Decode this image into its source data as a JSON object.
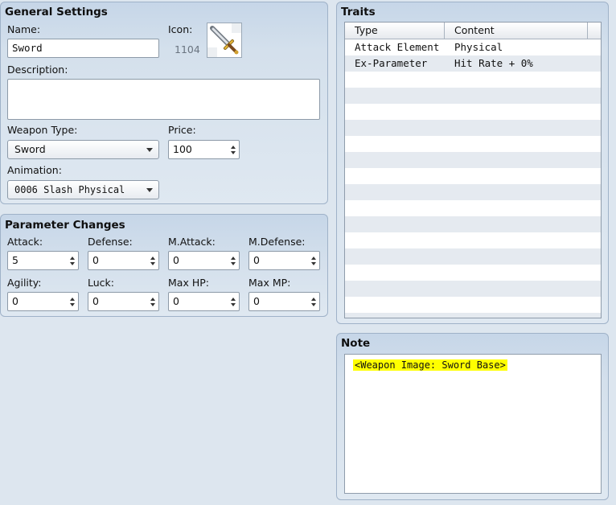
{
  "general": {
    "title": "General Settings",
    "name_label": "Name:",
    "name_value": "Sword",
    "icon_label": "Icon:",
    "icon_index": "1104",
    "description_label": "Description:",
    "description_value": "",
    "weapon_type_label": "Weapon Type:",
    "weapon_type_value": "Sword",
    "price_label": "Price:",
    "price_value": "100",
    "animation_label": "Animation:",
    "animation_value": "0006 Slash Physical"
  },
  "params": {
    "title": "Parameter Changes",
    "items": [
      {
        "label": "Attack:",
        "value": "5"
      },
      {
        "label": "Defense:",
        "value": "0"
      },
      {
        "label": "M.Attack:",
        "value": "0"
      },
      {
        "label": "M.Defense:",
        "value": "0"
      },
      {
        "label": "Agility:",
        "value": "0"
      },
      {
        "label": "Luck:",
        "value": "0"
      },
      {
        "label": "Max HP:",
        "value": "0"
      },
      {
        "label": "Max MP:",
        "value": "0"
      }
    ]
  },
  "traits": {
    "title": "Traits",
    "columns": [
      "Type",
      "Content"
    ],
    "rows": [
      {
        "type": "Attack Element",
        "content": "Physical"
      },
      {
        "type": "Ex-Parameter",
        "content": "Hit Rate + 0%"
      }
    ]
  },
  "note": {
    "title": "Note",
    "text": "<Weapon Image: Sword Base>",
    "highlight_color": "#ffff00"
  }
}
